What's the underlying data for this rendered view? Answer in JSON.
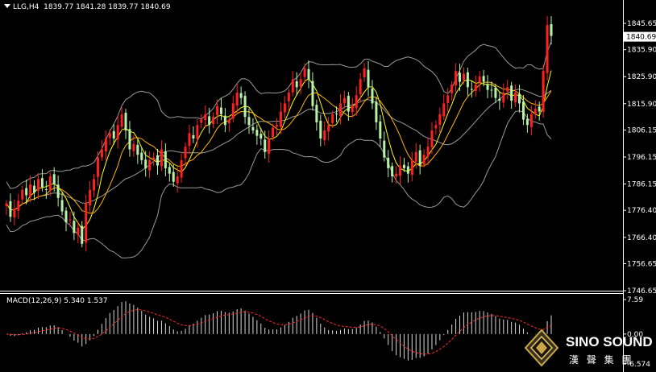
{
  "header": {
    "symbol": "LLG,H4",
    "ohlc": "1839.77 1841.28 1839.77 1840.69"
  },
  "macd_header": {
    "label": "MACD(12,26,9)",
    "values": "5.340 1.537"
  },
  "price_axis_labels": [
    "1845.65",
    "1835.90",
    "1825.90",
    "1815.90",
    "1806.15",
    "1796.15",
    "1786.15",
    "1776.40",
    "1766.40",
    "1756.65",
    "1746.65"
  ],
  "current_price_tag": "1840.69",
  "macd_axis_labels": [
    "7.59",
    "0.00",
    "-6.574"
  ],
  "logo": {
    "text": "SINO SOUND",
    "chinese": "漢 聲 集 團"
  },
  "colors": {
    "background": "#000000",
    "bull": "#ff2020",
    "bear": "#b8f2a8",
    "ma_fast": "#ffff00",
    "ma_mid": "#ffb400",
    "bollinger": "#9a9a9a",
    "macd_signal": "#ff2a2a",
    "macd_hist": "#d8d8d8",
    "axis": "#ffffff"
  },
  "chart_data": {
    "type": "candlestick",
    "title": "LLG,H4",
    "ylim": [
      1746.65,
      1848
    ],
    "close_series": [
      1779,
      1774,
      1777,
      1780,
      1784,
      1782,
      1786,
      1783,
      1788,
      1785,
      1784,
      1789,
      1786,
      1781,
      1776,
      1772,
      1773,
      1768,
      1770,
      1764,
      1779,
      1784,
      1788,
      1796,
      1799,
      1803,
      1805,
      1803,
      1808,
      1812,
      1806,
      1799,
      1801,
      1797,
      1795,
      1792,
      1795,
      1796,
      1793,
      1799,
      1792,
      1790,
      1787,
      1789,
      1795,
      1800,
      1805,
      1803,
      1808,
      1810,
      1812,
      1808,
      1811,
      1815,
      1812,
      1808,
      1810,
      1816,
      1820,
      1818,
      1811,
      1808,
      1806,
      1804,
      1803,
      1798,
      1803,
      1807,
      1808,
      1813,
      1816,
      1820,
      1825,
      1822,
      1825,
      1829,
      1825,
      1815,
      1809,
      1803,
      1806,
      1808,
      1812,
      1812,
      1816,
      1818,
      1813,
      1815,
      1819,
      1825,
      1829,
      1822,
      1816,
      1809,
      1803,
      1796,
      1792,
      1789,
      1790,
      1793,
      1792,
      1790,
      1795,
      1798,
      1793,
      1797,
      1800,
      1806,
      1808,
      1812,
      1816,
      1819,
      1823,
      1828,
      1824,
      1827,
      1822,
      1821,
      1823,
      1826,
      1824,
      1821,
      1821,
      1818,
      1817,
      1820,
      1822,
      1817,
      1820,
      1816,
      1810,
      1808,
      1812,
      1814,
      1813,
      1828,
      1845,
      1841
    ],
    "series": [
      {
        "name": "MA (fast)",
        "type": "line"
      },
      {
        "name": "MA (slow)",
        "type": "line"
      },
      {
        "name": "Bollinger Bands",
        "type": "band"
      }
    ],
    "macd": {
      "name": "MACD(12,26,9)",
      "value": 5.34,
      "signal": 1.537,
      "ylim": [
        -6.574,
        7.59
      ]
    }
  }
}
